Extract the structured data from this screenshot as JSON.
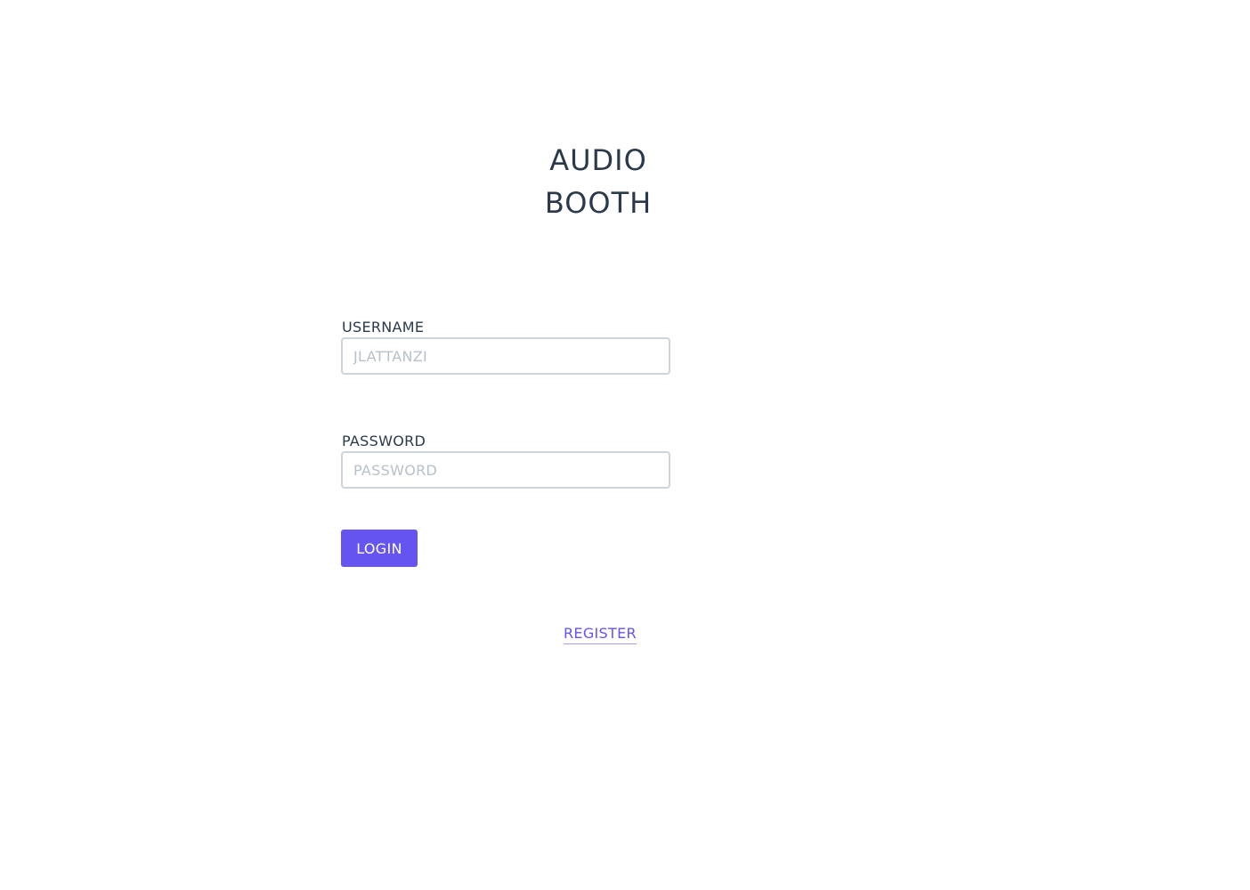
{
  "app": {
    "title_line1": "AUDIO",
    "title_line2": "BOOTH"
  },
  "login_form": {
    "username_label": "USERNAME",
    "username_placeholder": "JLATTANZI",
    "username_value": "",
    "password_label": "PASSWORD",
    "password_placeholder": "PASSWORD",
    "password_value": "",
    "login_button_label": "LOGIN"
  },
  "register_link_label": "REGISTER",
  "colors": {
    "accent": "#6554f0",
    "text": "#2a3a4c",
    "input_border": "#cdd4da",
    "placeholder": "#b7c1cb"
  }
}
